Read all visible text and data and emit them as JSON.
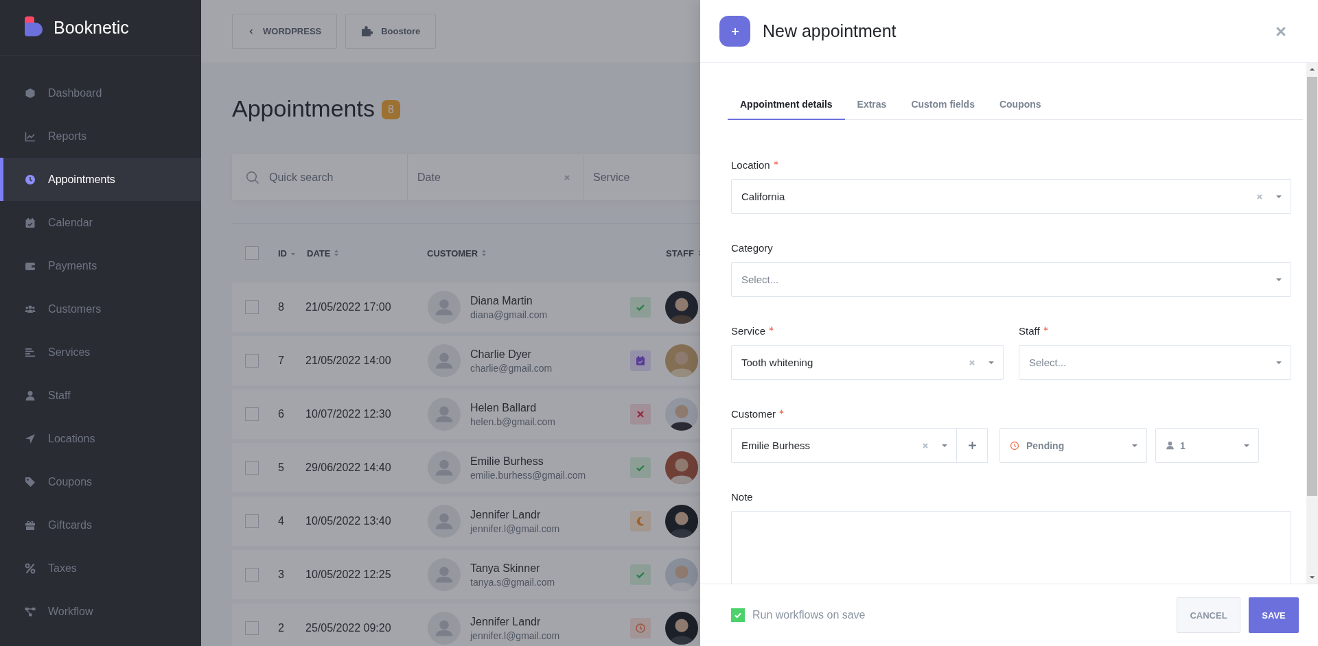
{
  "sidebar": {
    "brand": "Booknetic",
    "items": [
      {
        "label": "Dashboard",
        "selected": false
      },
      {
        "label": "Reports",
        "selected": false
      },
      {
        "label": "Appointments",
        "selected": true
      },
      {
        "label": "Calendar",
        "selected": false
      },
      {
        "label": "Payments",
        "selected": false
      },
      {
        "label": "Customers",
        "selected": false
      },
      {
        "label": "Services",
        "selected": false
      },
      {
        "label": "Staff",
        "selected": false
      },
      {
        "label": "Locations",
        "selected": false
      },
      {
        "label": "Coupons",
        "selected": false
      },
      {
        "label": "Giftcards",
        "selected": false
      },
      {
        "label": "Taxes",
        "selected": false
      },
      {
        "label": "Workflow",
        "selected": false
      }
    ]
  },
  "topbar": {
    "buttons": [
      "WORDPRESS",
      "Boostore"
    ]
  },
  "page": {
    "title": "Appointments",
    "count": "8"
  },
  "filters": {
    "search_placeholder": "Quick search",
    "date_placeholder": "Date",
    "service_placeholder": "Service"
  },
  "table": {
    "all_checked": false,
    "columns": [
      "ID",
      "DATE",
      "CUSTOMER",
      "STAFF"
    ],
    "rows": [
      {
        "id": "8",
        "date": "21/05/2022 17:00",
        "customer": "Diana Martin",
        "email": "diana@gmail.com",
        "kind": "approved",
        "checked": false
      },
      {
        "id": "7",
        "date": "21/05/2022 14:00",
        "customer": "Charlie Dyer",
        "email": "charlie@gmail.com",
        "kind": "scheduled",
        "checked": false
      },
      {
        "id": "6",
        "date": "10/07/2022 12:30",
        "customer": "Helen Ballard",
        "email": "helen.b@gmail.com",
        "kind": "canceled",
        "checked": false
      },
      {
        "id": "5",
        "date": "29/06/2022 14:40",
        "customer": "Emilie Burhess",
        "email": "emilie.burhess@gmail.com",
        "kind": "approved",
        "checked": false
      },
      {
        "id": "4",
        "date": "10/05/2022 13:40",
        "customer": "Jennifer Landr",
        "email": "jennifer.l@gmail.com",
        "kind": "night",
        "checked": false
      },
      {
        "id": "3",
        "date": "10/05/2022 12:25",
        "customer": "Tanya Skinner",
        "email": "tanya.s@gmail.com",
        "kind": "approved",
        "checked": false
      },
      {
        "id": "2",
        "date": "25/05/2022 09:20",
        "customer": "Jennifer Landr",
        "email": "jennifer.l@gmail.com",
        "kind": "pending",
        "checked": false
      }
    ]
  },
  "modal": {
    "title": "New appointment",
    "tabs": [
      {
        "label": "Appointment details",
        "selected": true
      },
      {
        "label": "Extras",
        "selected": false
      },
      {
        "label": "Custom fields",
        "selected": false
      },
      {
        "label": "Coupons",
        "selected": false
      }
    ],
    "location": {
      "label": "Location",
      "required": true,
      "value": "California"
    },
    "category": {
      "label": "Category",
      "placeholder": "Select..."
    },
    "service": {
      "label": "Service",
      "required": true,
      "value": "Tooth whitening"
    },
    "staff": {
      "label": "Staff",
      "required": true,
      "placeholder": "Select..."
    },
    "customer": {
      "label": "Customer",
      "required": true,
      "value": "Emilie Burhess"
    },
    "status": {
      "value": "Pending"
    },
    "count": {
      "value": "1"
    },
    "note": {
      "label": "Note"
    },
    "run_workflows": {
      "label": "Run workflows on save",
      "checked": true
    },
    "buttons": {
      "cancel": "CANCEL",
      "save": "SAVE"
    }
  }
}
